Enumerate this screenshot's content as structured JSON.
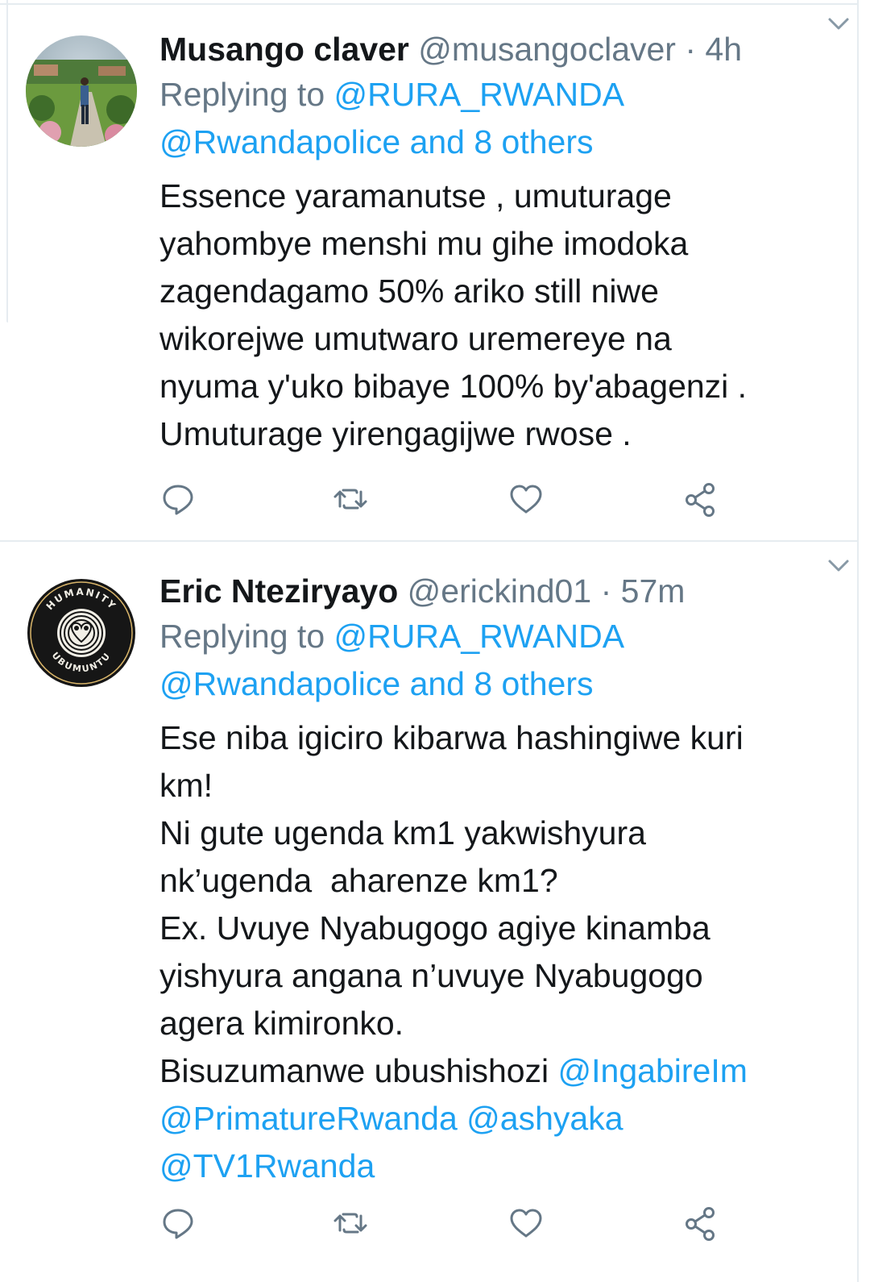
{
  "tweets": [
    {
      "author_name": "Musango claver",
      "handle": "@musangoclaver",
      "separator": "·",
      "time": "4h",
      "replying_prefix": "Replying to",
      "replying_to_1": "@RURA_RWANDA",
      "replying_to_2": "@Rwandapolice and 8 others",
      "body": "Essence yaramanutse , umuturage\nyahombye menshi mu gihe imodoka\nzagendagamo 50% ariko still niwe\nwikorejwe umutwaro uremereye na\nnyuma y'uko bibaye 100% by'abagenzi .\nUmuturage yirengagijwe rwose .",
      "avatar": "photo-avatar-person-garden",
      "icons": [
        "reply-icon",
        "retweet-icon",
        "like-icon",
        "share-icon",
        "chevron-down-icon"
      ]
    },
    {
      "author_name": "Eric Nteziryayo",
      "handle": "@erickind01",
      "separator": "·",
      "time": "57m",
      "replying_prefix": "Replying to",
      "replying_to_1": "@RURA_RWANDA",
      "replying_to_2": "@Rwandapolice and 8 others",
      "body": "Ese niba igiciro kibarwa hashingiwe kuri\nkm!\nNi gute ugenda km1 yakwishyura\nnk’ugenda  aharenze km1?\nEx. Uvuye Nyabugogo agiye kinamba\nyishyura angana n’uvuye Nyabugogo\nagera kimironko.\nBisuzumanwe ubushishozi ",
      "body_mention_1": "@IngabireIm",
      "body_mention_2": "@PrimatureRwanda",
      "body_mention_3": "@ashyaka",
      "body_mention_4": "@TV1Rwanda",
      "avatar": "logo-avatar-humanity-ubumuntu",
      "avatar_text_top": "HUMANITY",
      "avatar_text_bottom": "UBUMUNTU",
      "icons": [
        "reply-icon",
        "retweet-icon",
        "like-icon",
        "share-icon",
        "chevron-down-icon"
      ]
    }
  ],
  "colors": {
    "text": "#14171a",
    "secondary": "#657786",
    "link": "#1da1f2",
    "divider": "#e6ecf0"
  }
}
